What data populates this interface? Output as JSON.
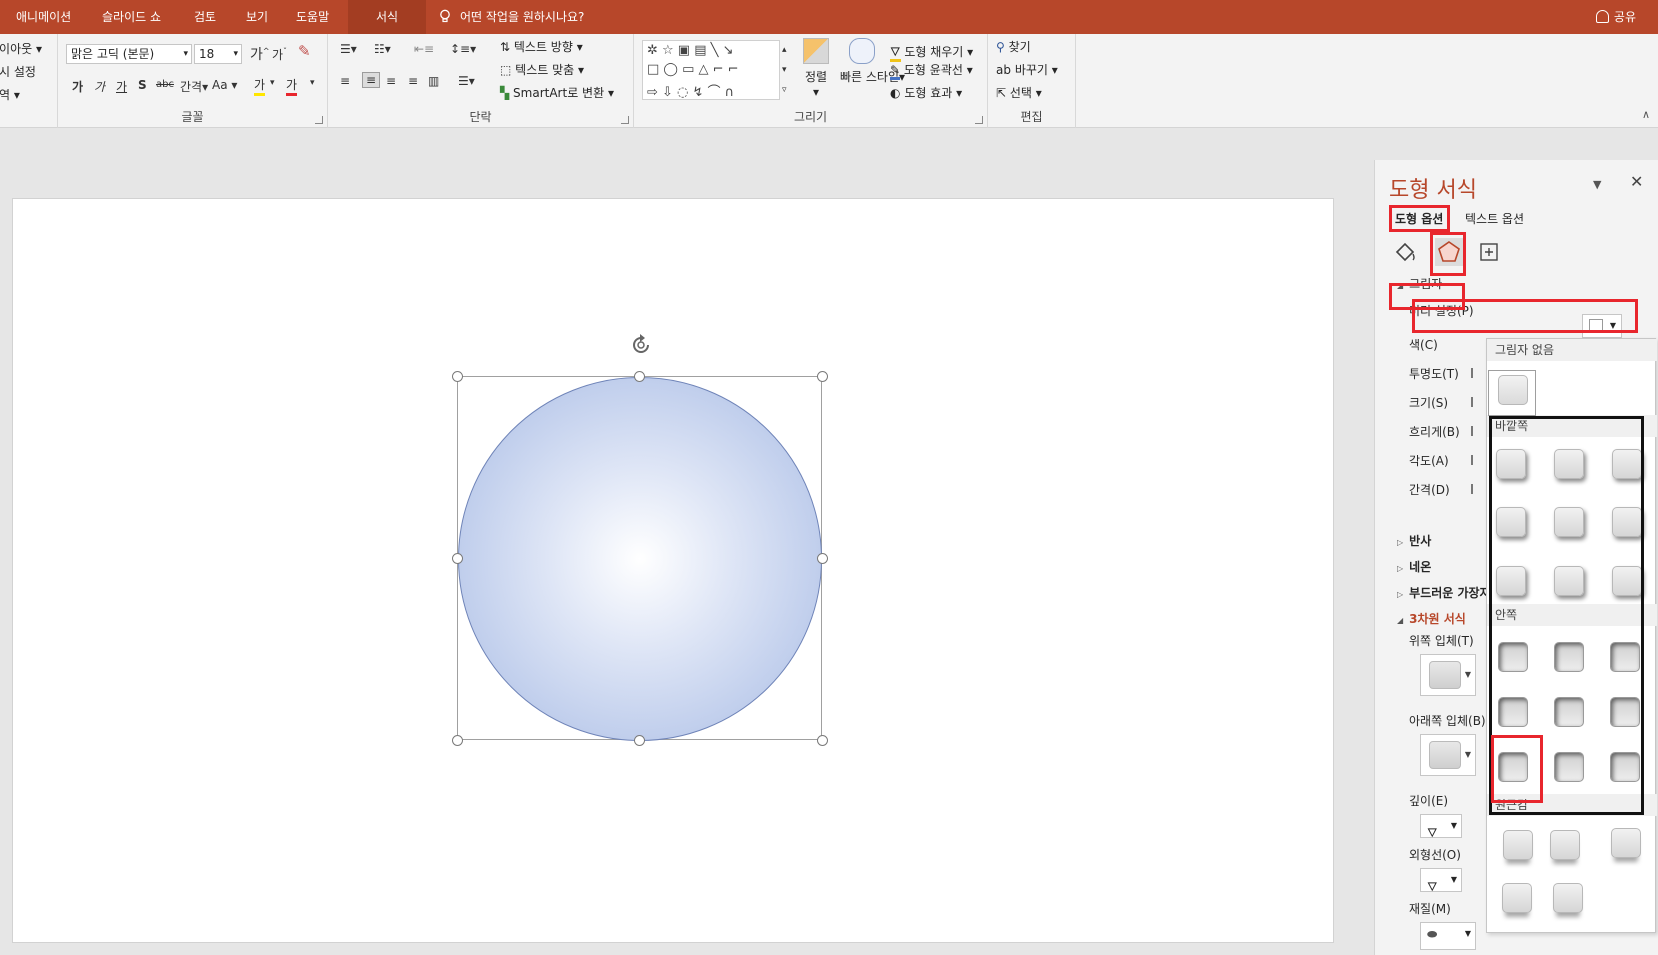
{
  "menubar": {
    "tabs": [
      "애니메이션",
      "슬라이드 쇼",
      "검토",
      "보기",
      "도움말",
      "서식"
    ],
    "tell_me": "어떤 작업을 원하시나요?",
    "share": "공유"
  },
  "ribbon": {
    "slide_group": {
      "layout": "레이아웃",
      "reset": "다시 설정",
      "section": "구역"
    },
    "font_group": {
      "label": "글꼴",
      "font_name": "맑은 고딕 (본문)",
      "font_size": "18",
      "grow": "가",
      "shrink": "가",
      "bold": "가",
      "italic": "가",
      "underline": "가",
      "shadow": "S",
      "strike": "abc",
      "spacing": "간격",
      "case": "Aa",
      "highlight": "가",
      "font_color": "가"
    },
    "paragraph_group": {
      "label": "단락",
      "text_direction": "텍스트 방향",
      "align_text": "텍스트 맞춤",
      "smartart": "SmartArt로 변환"
    },
    "drawing_group": {
      "label": "그리기",
      "arrange": "정렬",
      "quick_styles": "빠른 스타일",
      "shape_fill": "도형 채우기",
      "shape_outline": "도형 윤곽선",
      "shape_effects": "도형 효과"
    },
    "editing_group": {
      "label": "편집",
      "find": "찾기",
      "replace": "바꾸기",
      "select": "선택"
    }
  },
  "pane": {
    "title": "도형 서식",
    "tab_shape": "도형 옵션",
    "tab_text": "텍스트 옵션",
    "section_shadow": "그림자",
    "presets": "미리 설정(P)",
    "props": [
      "색(C)",
      "투명도(T)",
      "크기(S)",
      "흐리게(B)",
      "각도(A)",
      "간격(D)"
    ],
    "section_reflection": "반사",
    "section_glow": "네온",
    "section_soft_edges": "부드러운 가장자리",
    "section_3d": "3차원 서식",
    "top_bevel": "위쪽 입체(T)",
    "bottom_bevel": "아래쪽 입체(B)",
    "depth": "깊이(E)",
    "contour": "외형선(O)",
    "material": "재질(M)"
  },
  "gallery": {
    "no_shadow": "그림자 없음",
    "outer": "바깥쪽",
    "inner": "안쪽",
    "perspective": "원근감"
  },
  "colors": {
    "accent": "#b7472a",
    "annotation_red": "#e8262d",
    "annotation_black": "#111111",
    "shape_fill": "#bccbeb",
    "shape_outline": "#6f84b8"
  }
}
